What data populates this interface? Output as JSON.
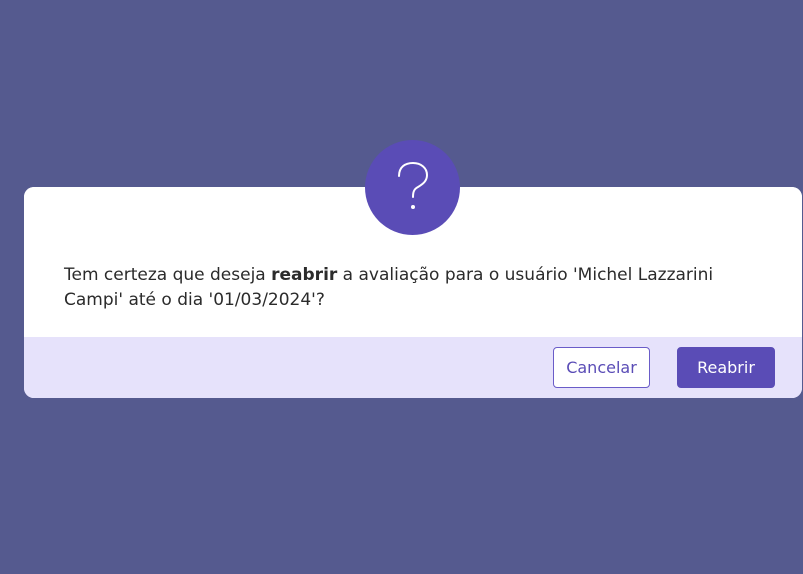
{
  "dialog": {
    "icon": "question-icon",
    "message_pre": "Tem certeza que deseja ",
    "message_bold": "reabrir",
    "message_post": " a avaliação para o usuário 'Michel Lazzarini Campi' até o dia '01/03/2024'?",
    "cancel_label": "Cancelar",
    "confirm_label": "Reabrir"
  },
  "colors": {
    "backdrop": "#555a8f",
    "accent": "#5a4cb6",
    "footer": "#e6e2fb"
  }
}
